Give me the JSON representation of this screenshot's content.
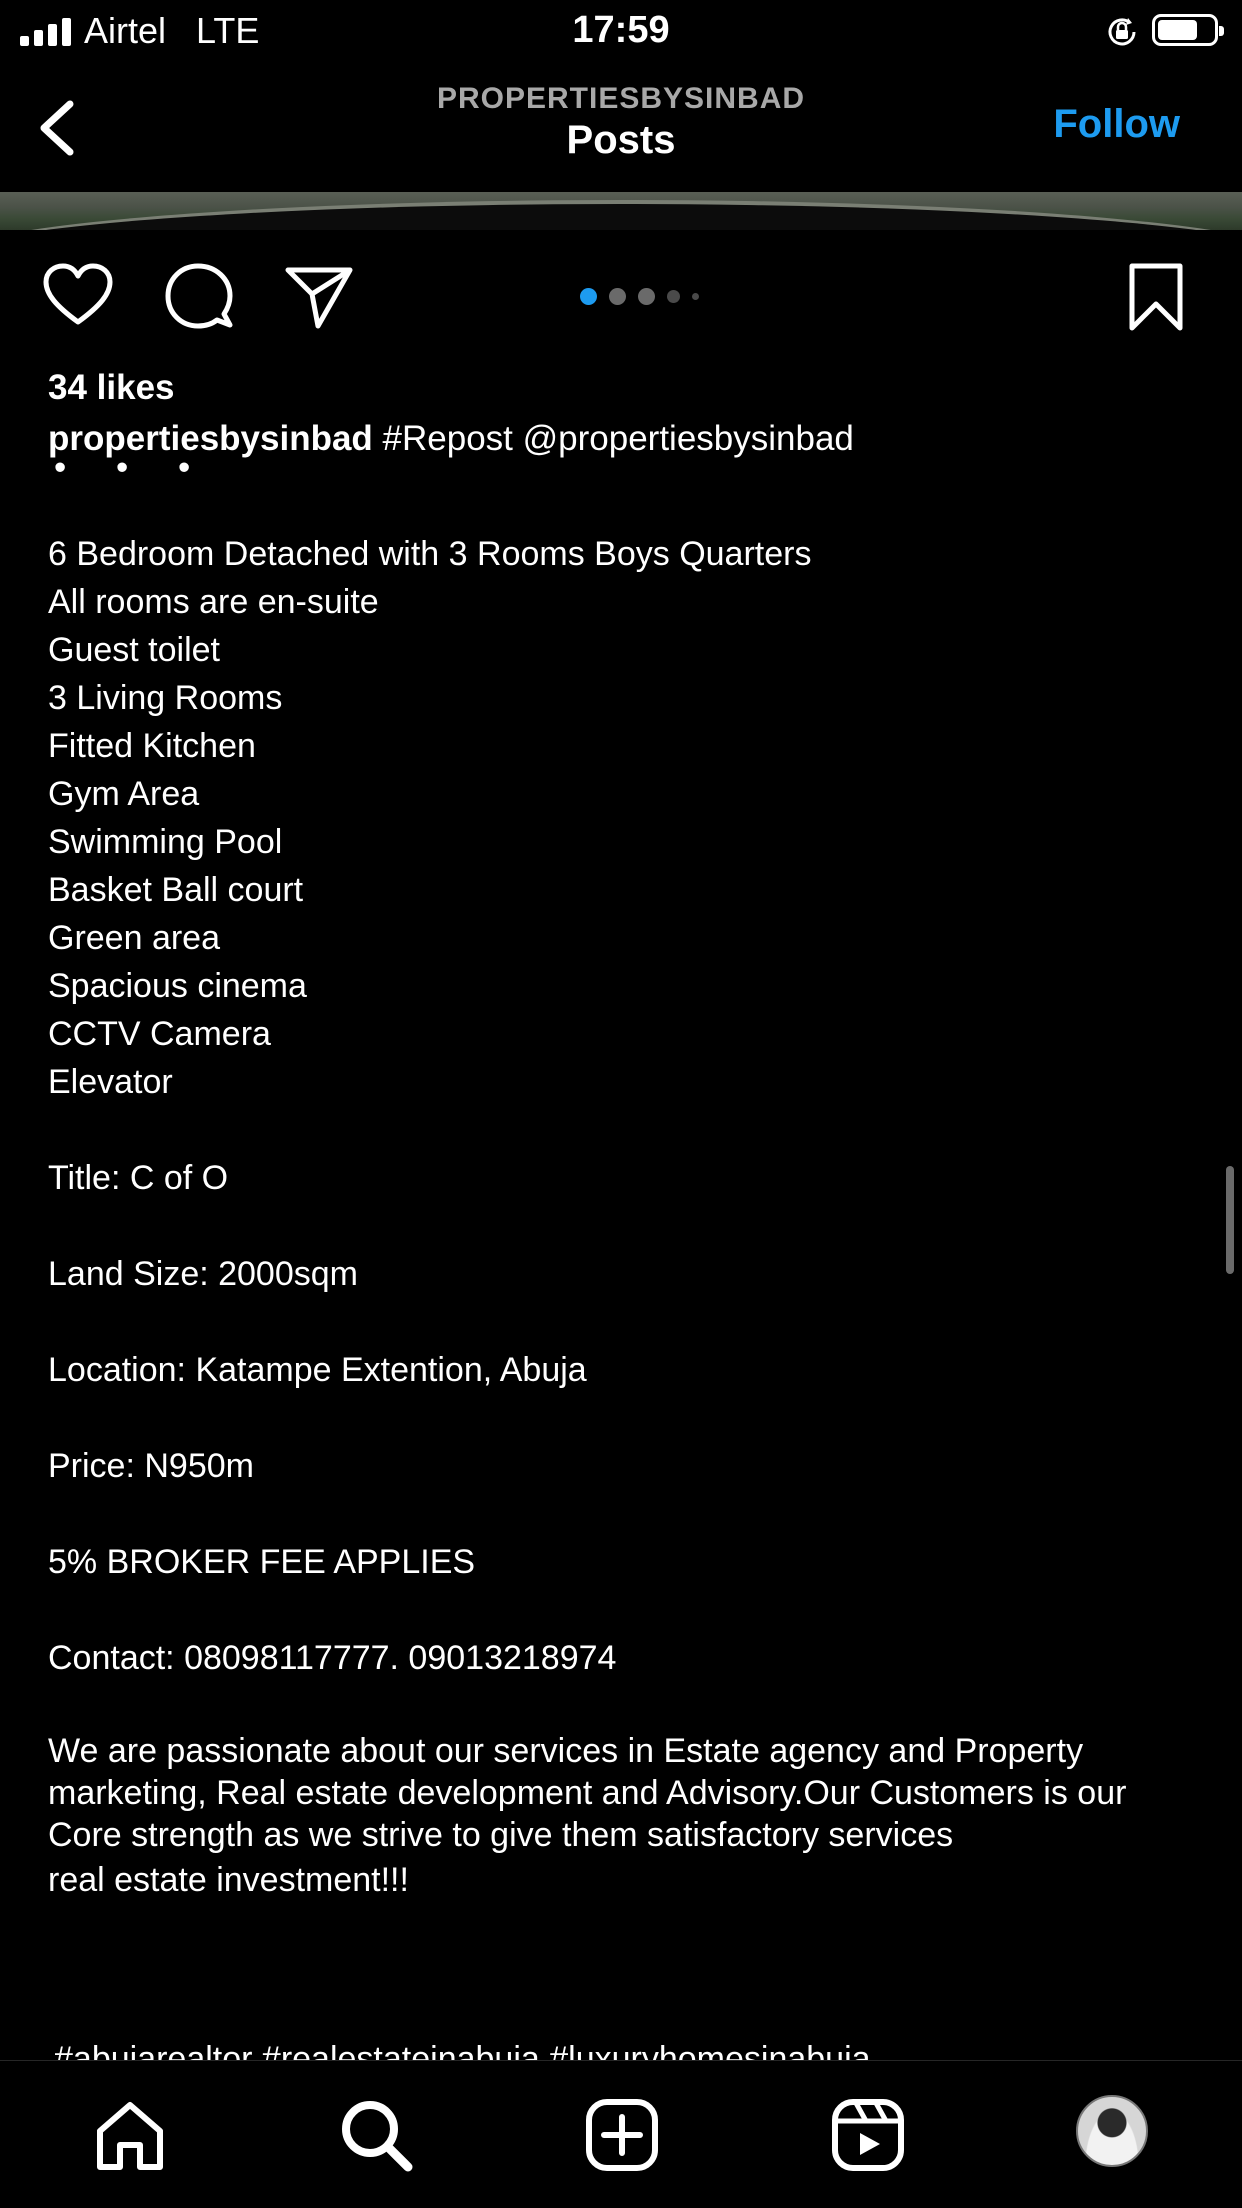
{
  "status_bar": {
    "carrier": "Airtel",
    "network": "LTE",
    "time": "17:59",
    "battery_level": 0.72
  },
  "header": {
    "account": "PROPERTIESBYSINBAD",
    "title": "Posts",
    "follow_label": "Follow"
  },
  "post": {
    "carousel": {
      "count": 5,
      "active_index": 0
    },
    "likes": "34 likes",
    "username": "propertiesbysinbad",
    "caption_first_line": "#Repost @propertiesbysinbad",
    "ellipsis": "• • •",
    "caption_lines": [
      "6 Bedroom Detached with 3 Rooms Boys Quarters",
      "All rooms are en-suite",
      "Guest toilet",
      "3 Living Rooms",
      "Fitted Kitchen",
      "Gym Area",
      "Swimming Pool",
      "Basket Ball court",
      "Green area",
      "Spacious cinema",
      "CCTV Camera",
      "Elevator"
    ],
    "title_line": "Title: C of O",
    "land_size": "Land Size: 2000sqm",
    "location": "Location: Katampe Extention, Abuja",
    "price": "Price: N950m",
    "broker_fee": "5% BROKER FEE APPLIES",
    "contact": "Contact:  08098117777. 09013218974",
    "about": "We are passionate about our services in Estate agency and Property marketing, Real estate development and Advisory.Our Customers is our Core strength as we strive to give them satisfactory services",
    "closing": "real estate investment!!!",
    "hashtags": " #abujarealtor #realestateinabuja #luxuryhomesinabuja"
  },
  "icons": {
    "back": "chevron-left-icon",
    "like": "heart-icon",
    "comment": "comment-icon",
    "share": "paper-plane-icon",
    "save": "bookmark-icon",
    "tabs": [
      "home-icon",
      "search-icon",
      "add-post-icon",
      "reels-icon",
      "profile-avatar"
    ]
  },
  "colors": {
    "background": "#000000",
    "accent": "#1d9bf0",
    "active_dot": "#1d9bf0",
    "muted": "#a8a8a8"
  }
}
